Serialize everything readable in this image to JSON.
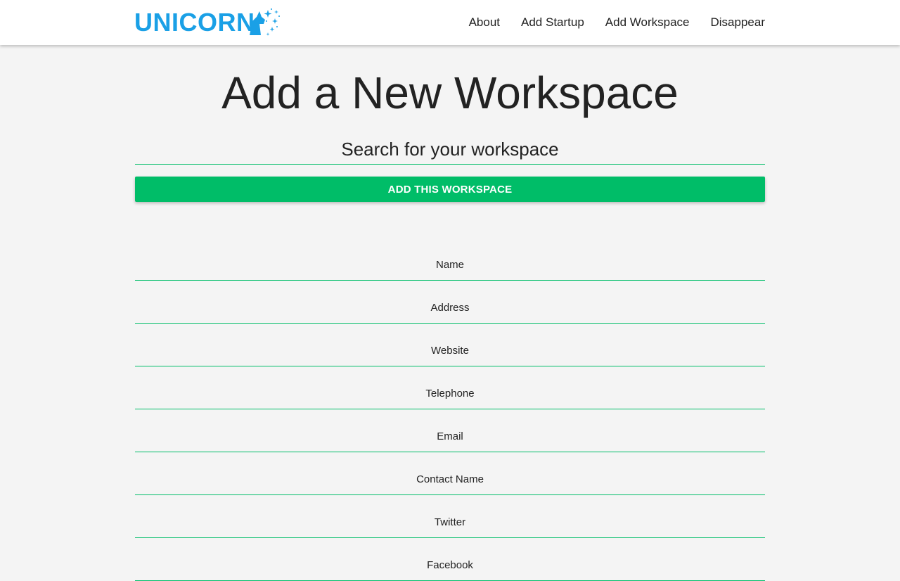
{
  "brand": {
    "name": "UNICORN",
    "color": "#1aa0e6",
    "icon": "unicorn-sparkle-icon"
  },
  "nav": {
    "items": [
      {
        "label": "About"
      },
      {
        "label": "Add Startup"
      },
      {
        "label": "Add Workspace"
      },
      {
        "label": "Disappear"
      }
    ]
  },
  "page": {
    "title": "Add a New Workspace"
  },
  "search": {
    "placeholder": "Search for your workspace",
    "value": ""
  },
  "actions": {
    "add_label": "ADD THIS WORKSPACE",
    "accent_color": "#00bd68"
  },
  "form": {
    "fields": [
      {
        "placeholder": "Name",
        "value": ""
      },
      {
        "placeholder": "Address",
        "value": ""
      },
      {
        "placeholder": "Website",
        "value": ""
      },
      {
        "placeholder": "Telephone",
        "value": ""
      },
      {
        "placeholder": "Email",
        "value": ""
      },
      {
        "placeholder": "Contact Name",
        "value": ""
      },
      {
        "placeholder": "Twitter",
        "value": ""
      },
      {
        "placeholder": "Facebook",
        "value": ""
      }
    ]
  }
}
